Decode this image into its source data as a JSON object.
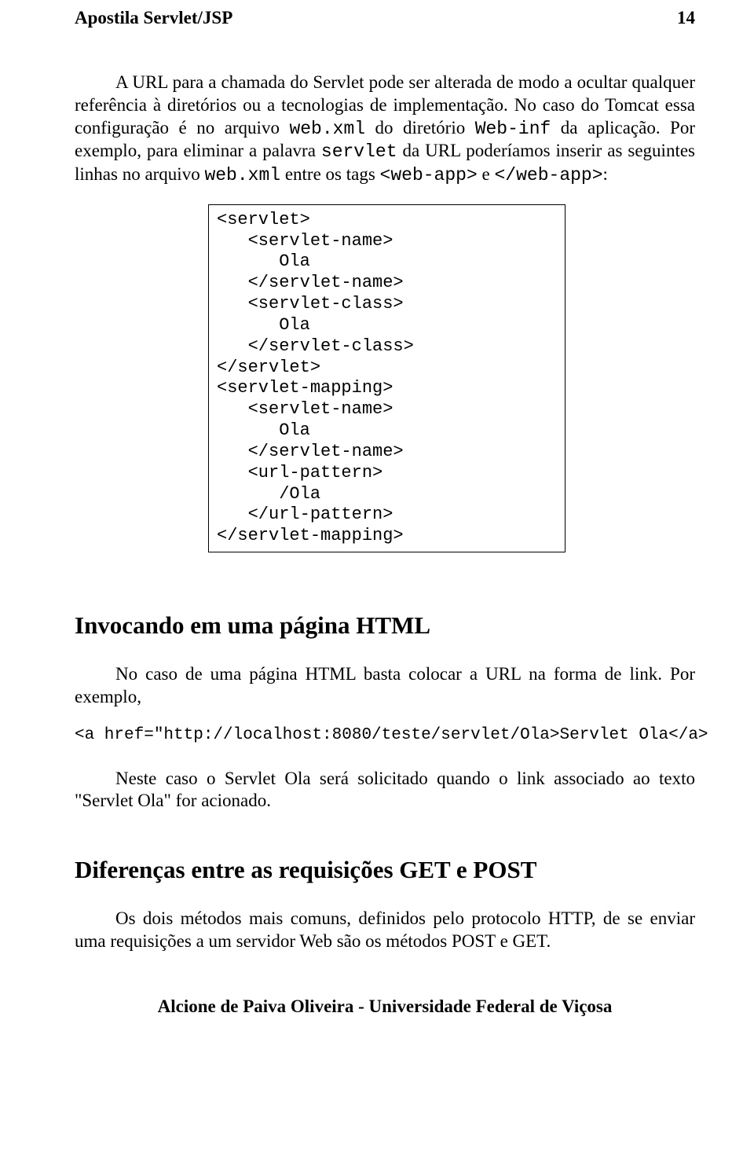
{
  "header": {
    "title": "Apostila Servlet/JSP",
    "page_number": "14"
  },
  "paragraphs": {
    "p1_a": "A URL para a chamada do Servlet pode ser alterada de modo a ocultar qualquer referência à diretórios ou a tecnologias de implementação. No caso do Tomcat essa configuração é no arquivo ",
    "p1_code1": "web.xml",
    "p1_b": " do diretório ",
    "p1_code2": "Web-inf",
    "p1_c": " da aplicação. Por exemplo, para eliminar a palavra ",
    "p1_code3": "servlet",
    "p1_d": " da URL poderíamos inserir as seguintes linhas no arquivo ",
    "p1_code4": "web.xml",
    "p1_e": "  entre os tags ",
    "p1_code5": "<web-app>",
    "p1_f": " e ",
    "p1_code6": "</web-app>",
    "p1_g": ":"
  },
  "code_box": "<servlet>\n   <servlet-name>\n      Ola\n   </servlet-name>\n   <servlet-class>\n      Ola\n   </servlet-class>\n</servlet>\n<servlet-mapping>\n   <servlet-name>\n      Ola\n   </servlet-name>\n   <url-pattern>\n      /Ola\n   </url-pattern>\n</servlet-mapping>",
  "section1": {
    "title": "Invocando em uma página HTML",
    "p2": "No caso de uma página HTML basta colocar a URL na forma de link. Por exemplo,",
    "code_line": "<a href=\"http://localhost:8080/teste/servlet/Ola>Servlet Ola</a>",
    "p3": "Neste caso o Servlet Ola será solicitado quando o link associado ao texto \"Servlet Ola\" for acionado."
  },
  "section2": {
    "title": "Diferenças entre as requisições GET e POST",
    "p4": "Os dois métodos mais comuns, definidos pelo protocolo HTTP, de se enviar uma requisições a um servidor Web são os métodos POST e GET."
  },
  "footer": "Alcione de Paiva Oliveira - Universidade Federal de Viçosa"
}
